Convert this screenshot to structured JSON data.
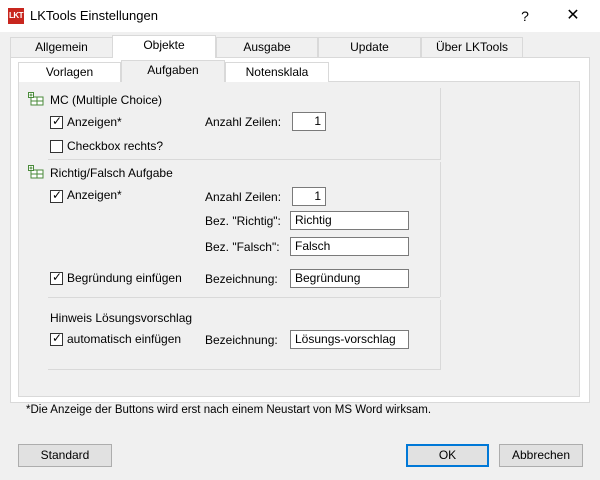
{
  "window": {
    "app_icon_text": "LKT",
    "title": "LKTools Einstellungen",
    "help_label": "?",
    "close_label": "✕"
  },
  "tabs": [
    "Allgemein",
    "Objekte",
    "Ausgabe",
    "Update",
    "Über LKTools"
  ],
  "subtabs": [
    "Vorlagen",
    "Aufgaben",
    "Notensklala"
  ],
  "mc": {
    "title": "MC (Multiple Choice)",
    "show_label": "Anzeigen*",
    "show_checked": true,
    "rows_label": "Anzahl Zeilen:",
    "rows_value": "1",
    "checkbox_right_label": "Checkbox rechts?",
    "checkbox_right_checked": false
  },
  "tf": {
    "title": "Richtig/Falsch Aufgabe",
    "show_label": "Anzeigen*",
    "show_checked": true,
    "rows_label": "Anzahl Zeilen:",
    "rows_value": "1",
    "true_label": "Bez. \"Richtig\":",
    "true_value": "Richtig",
    "false_label": "Bez. \"Falsch\":",
    "false_value": "Falsch",
    "reason_label": "Begründung einfügen",
    "reason_checked": true,
    "reason_name_label": "Bezeichnung:",
    "reason_name_value": "Begründung"
  },
  "hint": {
    "title": "Hinweis Lösungsvorschlag",
    "auto_label": "automatisch einfügen",
    "auto_checked": true,
    "name_label": "Bezeichnung:",
    "name_value": "Lösungs-vorschlag"
  },
  "footnote": "*Die Anzeige der Buttons wird erst nach einem Neustart von MS Word wirksam.",
  "buttons": {
    "standard": "Standard",
    "ok": "OK",
    "cancel": "Abbrechen"
  },
  "colors": {
    "app_icon": "#c8261e",
    "default_button_border": "#0078d7"
  }
}
